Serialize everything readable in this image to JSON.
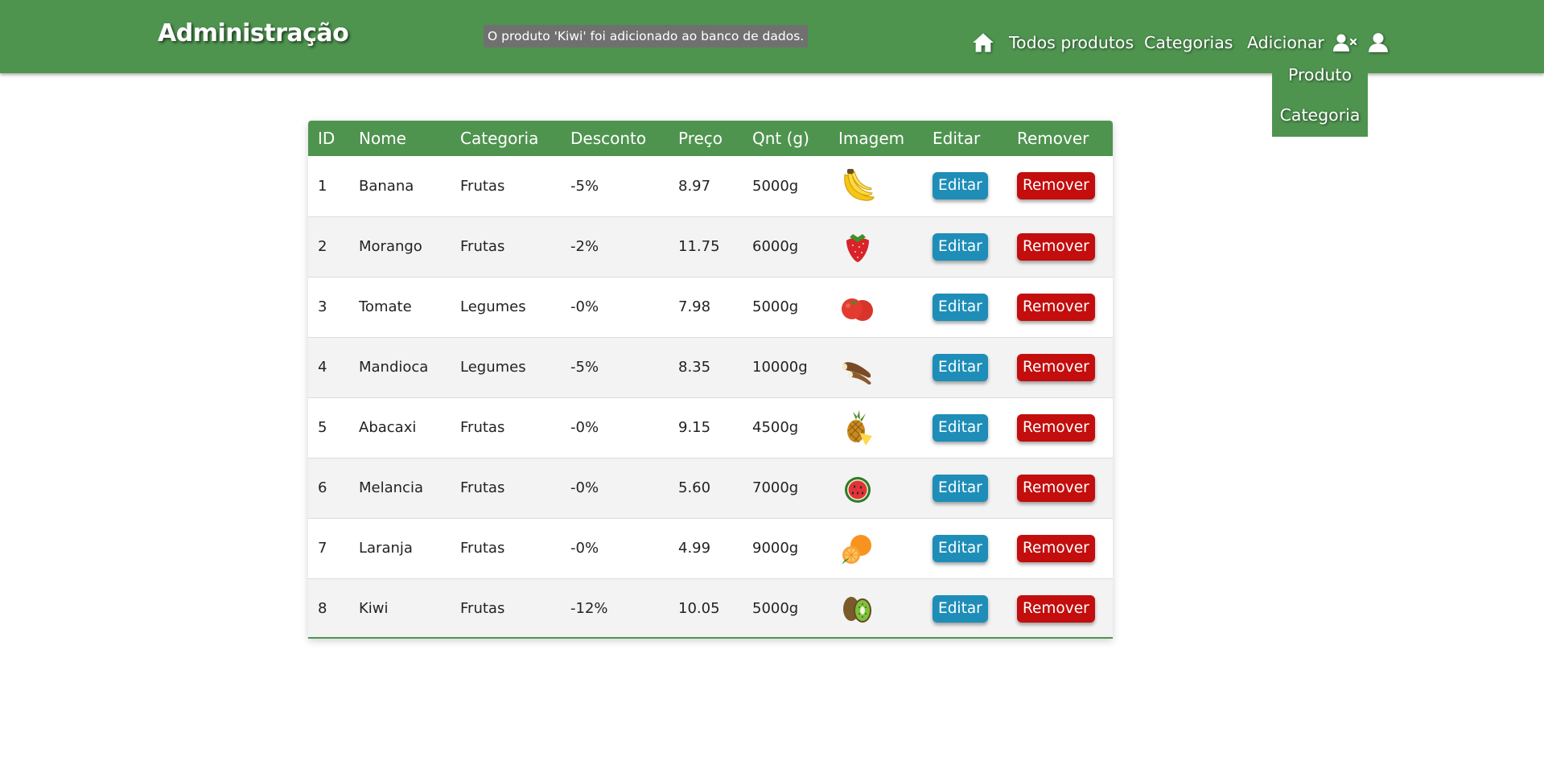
{
  "header": {
    "brand": "Administração",
    "flash_message": "O produto 'Kiwi' foi adicionado ao banco de dados.",
    "nav": {
      "home_icon": "home-icon",
      "all_products": "Todos produtos",
      "categories": "Categorias",
      "add": "Adicionar",
      "logout_icon": "user-x-icon",
      "user_icon": "user-icon"
    },
    "add_dropdown": [
      "Produto",
      "Categoria"
    ]
  },
  "colors": {
    "header_bg": "#4e944f",
    "edit_button": "#1e8eb8",
    "remove_button": "#c40d0d"
  },
  "table": {
    "headers": [
      "ID",
      "Nome",
      "Categoria",
      "Desconto",
      "Preço",
      "Qnt (g)",
      "Imagem",
      "Editar",
      "Remover"
    ],
    "edit_label": "Editar",
    "remove_label": "Remover",
    "rows": [
      {
        "id": "1",
        "name": "Banana",
        "category": "Frutas",
        "discount": "-5%",
        "price": "8.97",
        "qty": "5000g",
        "image": "banana"
      },
      {
        "id": "2",
        "name": "Morango",
        "category": "Frutas",
        "discount": "-2%",
        "price": "11.75",
        "qty": "6000g",
        "image": "strawberry"
      },
      {
        "id": "3",
        "name": "Tomate",
        "category": "Legumes",
        "discount": "-0%",
        "price": "7.98",
        "qty": "5000g",
        "image": "tomato"
      },
      {
        "id": "4",
        "name": "Mandioca",
        "category": "Legumes",
        "discount": "-5%",
        "price": "8.35",
        "qty": "10000g",
        "image": "cassava"
      },
      {
        "id": "5",
        "name": "Abacaxi",
        "category": "Frutas",
        "discount": "-0%",
        "price": "9.15",
        "qty": "4500g",
        "image": "pineapple"
      },
      {
        "id": "6",
        "name": "Melancia",
        "category": "Frutas",
        "discount": "-0%",
        "price": "5.60",
        "qty": "7000g",
        "image": "watermelon"
      },
      {
        "id": "7",
        "name": "Laranja",
        "category": "Frutas",
        "discount": "-0%",
        "price": "4.99",
        "qty": "9000g",
        "image": "orange"
      },
      {
        "id": "8",
        "name": "Kiwi",
        "category": "Frutas",
        "discount": "-12%",
        "price": "10.05",
        "qty": "5000g",
        "image": "kiwi"
      }
    ]
  }
}
